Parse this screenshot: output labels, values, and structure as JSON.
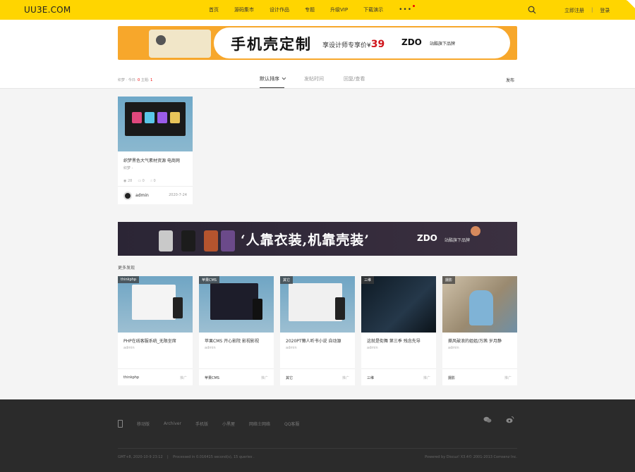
{
  "header": {
    "logo": "UU3E.COM",
    "nav": [
      "首页",
      "源码集市",
      "设计作品",
      "专题",
      "升级VIP",
      "下载演示"
    ],
    "more": "•••",
    "register": "立即注册",
    "login": "登录",
    "separator": "|",
    "colors": {
      "bar": "#ffd500"
    }
  },
  "banner_top": {
    "headline": "手机壳定制",
    "promo_text": "享设计师专享价¥",
    "price": "39",
    "brand": "ZDO",
    "brand_sub": "站酷旗下品牌"
  },
  "filters": {
    "stats_prefix": "织梦 · 今日: ",
    "stats_today": "0",
    "stats_mid": " 主题: ",
    "stats_topics": "1",
    "tabs": [
      "默认排序",
      "发帖时间",
      "回复/查看"
    ],
    "post": "发布"
  },
  "main_post": {
    "title": "织梦黑色大气素材资源 电商网",
    "category": "织梦 -",
    "views": "28",
    "comments": "0",
    "likes": "0",
    "author": "admin",
    "date": "2020-7-24"
  },
  "banner_mid": {
    "slogan": "‘人靠衣装,机靠壳装’",
    "brand": "ZDO",
    "brand_sub": "站酷旗下品牌"
  },
  "discover": {
    "title": "更多发现",
    "items": [
      {
        "tag": "thinkphp",
        "title": "PHP在线客服系统_无限坐席",
        "author": "admin",
        "category": "thinkphp",
        "ad": "推广"
      },
      {
        "tag": "苹果CMS",
        "title": "苹果CMS 开心影院 影视影视",
        "author": "admin",
        "category": "苹果CMS",
        "ad": "推广"
      },
      {
        "tag": "其它",
        "title": "2020PT懒人听书小说 自动源",
        "author": "admin",
        "category": "其它",
        "ad": "推广"
      },
      {
        "tag": "三维",
        "title": "这就是街舞 第三季 残念先导",
        "author": "admin",
        "category": "三维",
        "ad": "推广"
      },
      {
        "tag": "摄影",
        "title": "撕风破浪的姐姐/万茜 岁月静",
        "author": "admin",
        "category": "摄影",
        "ad": "推广"
      }
    ]
  },
  "footer": {
    "links": [
      "移动版",
      "Archiver",
      "手机版",
      "小黑屋",
      "网络士网络",
      "QQ客服"
    ],
    "left_time": "GMT+8, 2020-10-9 23:12",
    "separator": "|",
    "left_processed": "Processed in 0.016415 second(s), 15 queries .",
    "right": "Powered by Discuz! X3.4© 2001-2013 Comsenz Inc."
  }
}
